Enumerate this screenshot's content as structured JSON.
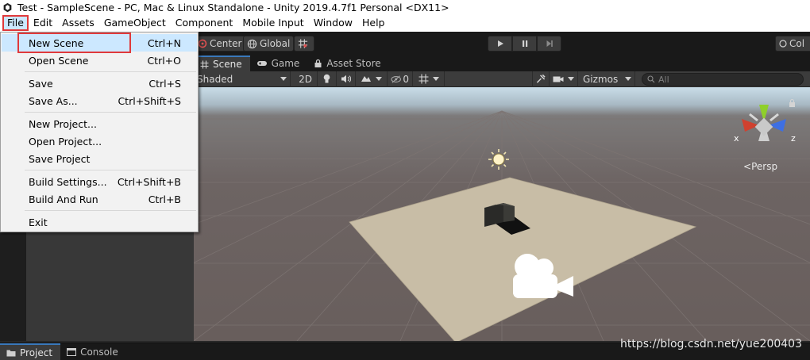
{
  "window": {
    "title": "Test - SampleScene - PC, Mac & Linux Standalone - Unity 2019.4.7f1 Personal <DX11>"
  },
  "menubar": [
    "File",
    "Edit",
    "Assets",
    "GameObject",
    "Component",
    "Mobile Input",
    "Window",
    "Help"
  ],
  "toolbar": {
    "pivot_label": "Center",
    "space_label": "Global",
    "collab_label": "Col"
  },
  "scene_tabs": [
    {
      "label": "Scene",
      "icon": "hash-icon"
    },
    {
      "label": "Game",
      "icon": "gamepad-icon"
    },
    {
      "label": "Asset Store",
      "icon": "store-icon"
    }
  ],
  "scene_toolbar": {
    "draw_mode": "Shaded",
    "mode_2d": "2D",
    "fx_count": "0",
    "gizmos_label": "Gizmos",
    "search_placeholder": "All"
  },
  "gizmo": {
    "x_label": "x",
    "z_label": "z",
    "persp_label": "Persp"
  },
  "file_menu": {
    "items": [
      {
        "label": "New Scene",
        "shortcut": "Ctrl+N"
      },
      {
        "label": "Open Scene",
        "shortcut": "Ctrl+O"
      },
      {
        "label": "Save",
        "shortcut": "Ctrl+S"
      },
      {
        "label": "Save As...",
        "shortcut": "Ctrl+Shift+S"
      },
      {
        "label": "New Project...",
        "shortcut": ""
      },
      {
        "label": "Open Project...",
        "shortcut": ""
      },
      {
        "label": "Save Project",
        "shortcut": ""
      },
      {
        "label": "Build Settings...",
        "shortcut": "Ctrl+Shift+B"
      },
      {
        "label": "Build And Run",
        "shortcut": "Ctrl+B"
      },
      {
        "label": "Exit",
        "shortcut": ""
      }
    ]
  },
  "bottom_tabs": [
    {
      "label": "Project",
      "icon": "folder-icon"
    },
    {
      "label": "Console",
      "icon": "console-icon"
    }
  ],
  "watermark": "https://blog.csdn.net/yue200403",
  "colors": {
    "highlight": "#cce8ff",
    "annotation_red": "#e0393b",
    "active_tab_accent": "#3a79bb"
  }
}
